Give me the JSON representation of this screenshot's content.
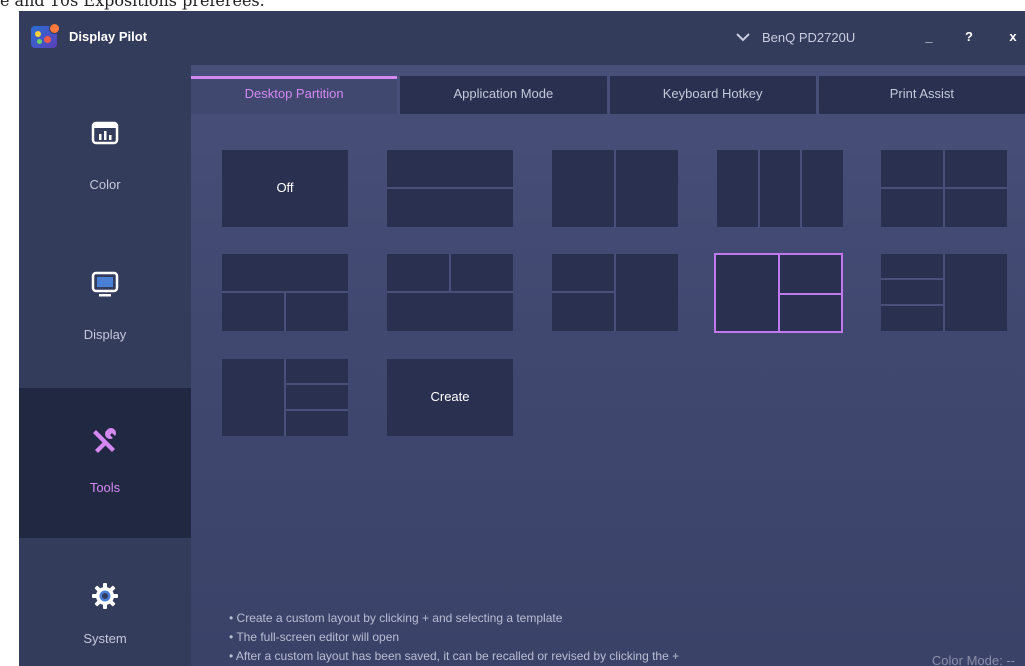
{
  "top_strip_text": "e and 10s Expositions preferees.",
  "app": {
    "title": "Display Pilot",
    "monitor_selector": "BenQ PD2720U",
    "minimize": "_",
    "help": "?",
    "close": "x"
  },
  "sidebar": {
    "items": [
      {
        "label": "Color",
        "icon": "color-chart-icon"
      },
      {
        "label": "Display",
        "icon": "monitor-icon"
      },
      {
        "label": "Tools",
        "icon": "tools-icon",
        "active": true
      },
      {
        "label": "System",
        "icon": "gear-icon"
      }
    ]
  },
  "tabs": [
    {
      "label": "Desktop Partition",
      "active": true
    },
    {
      "label": "Application Mode"
    },
    {
      "label": "Keyboard Hotkey"
    },
    {
      "label": "Print Assist"
    }
  ],
  "partition": {
    "off_label": "Off",
    "create_label": "Create",
    "selected_layout": "two-left-left-right-split-right"
  },
  "help": {
    "lines": [
      "• Create a custom layout by clicking + and selecting a template",
      "• The full-screen editor will open",
      "• After a custom layout has been saved, it can be recalled or revised by clicking the +"
    ]
  },
  "status": {
    "color_mode": "Color Mode: --"
  },
  "colors": {
    "accent": "#d489f2",
    "selected_border": "#bf78ee",
    "sidebar_bg": "#343c5c",
    "active_nav_bg": "#212842",
    "tile_bg": "#2a3050"
  }
}
